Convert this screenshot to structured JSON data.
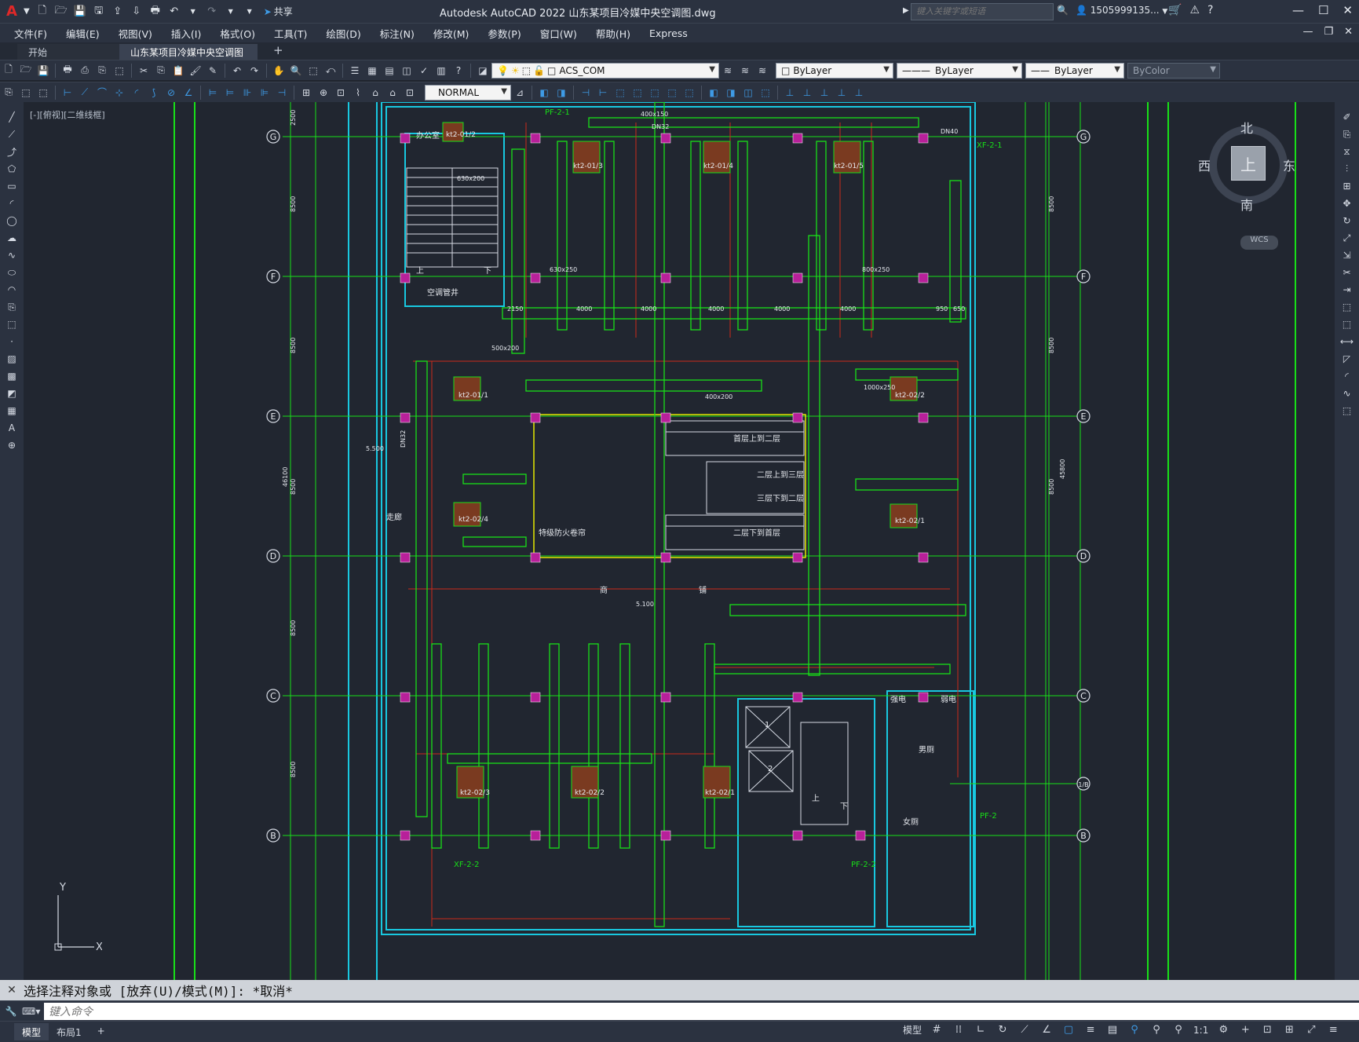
{
  "app": {
    "logo": "A",
    "title": "Autodesk AutoCAD 2022    山东某项目冷媒中央空调图.dwg",
    "share_label": "共享",
    "search_placeholder": "键入关键字或短语",
    "user": "1505999135...",
    "window_controls": [
      "—",
      "☐",
      "✕"
    ]
  },
  "menu": {
    "items": [
      "文件(F)",
      "编辑(E)",
      "视图(V)",
      "插入(I)",
      "格式(O)",
      "工具(T)",
      "绘图(D)",
      "标注(N)",
      "修改(M)",
      "参数(P)",
      "窗口(W)",
      "帮助(H)",
      "Express"
    ],
    "right_controls": [
      "—",
      "❐",
      "✕"
    ]
  },
  "tabs": {
    "start": "开始",
    "doc": "山东某项目冷媒中央空调图*",
    "close": "✕",
    "add": "+"
  },
  "toolbar": {
    "layer_value": "ACS_COM",
    "color_value": "ByLayer",
    "linetype_value": "ByLayer",
    "lineweight_value": "ByLayer",
    "plotstyle_value": "ByColor",
    "dimstyle_value": "NORMAL"
  },
  "canvas": {
    "view_label": "[-][俯视][二维线框]",
    "viewcube": {
      "n": "北",
      "s": "南",
      "e": "东",
      "w": "西",
      "top": "上",
      "wcs": "WCS"
    },
    "ucs": {
      "x": "X",
      "y": "Y"
    },
    "grid_labels_left": [
      "G",
      "F",
      "E",
      "D",
      "C",
      "B"
    ],
    "grid_labels_right": [
      "G",
      "F",
      "E",
      "D",
      "C",
      "1/B",
      "B"
    ],
    "room_labels": {
      "office": "办公室",
      "ac_shaft": "空调管井",
      "corridor": "走廊",
      "fire_shutter": "特级防火卷帘",
      "escalator_1": "首层上到二层",
      "escalator_2": "二层上到三层",
      "escalator_3": "三层下到二层",
      "escalator_4": "二层下到首层",
      "shop_a": "商",
      "shop_b": "铺",
      "strong_elec": "强电",
      "weak_elec": "弱电",
      "mens_wc": "男厕",
      "womens_wc": "女厕",
      "elev_1": "1",
      "elev_2": "2",
      "up1": "上",
      "down1": "下",
      "up2": "上",
      "down2": "下"
    },
    "unit_labels": [
      "kt2-01/2",
      "kt2-01/3",
      "kt2-01/4",
      "kt2-01/5",
      "kt2-01/1",
      "kt2-02/4",
      "kt2-02/3",
      "kt2-02/2",
      "kt2-02/1",
      "kt2-02/2",
      "kt2-02/1"
    ],
    "fan_labels": {
      "pf21": "PF-2-1",
      "xf21": "XF-2-1",
      "xf22": "XF-2-2",
      "pf22": "PF-2-2",
      "pf2": "PF-2"
    },
    "dims_top": [
      "2150",
      "4000",
      "4000",
      "4000",
      "4000",
      "4000",
      "950",
      "650"
    ],
    "duct_sizes": [
      "400x150",
      "500x200",
      "630x250",
      "630x200",
      "1000x250",
      "800x250",
      "400x200"
    ],
    "left_dims": [
      "2500",
      "8500",
      "8500",
      "8500",
      "8500",
      "8500",
      "46100"
    ],
    "right_dims": [
      "8500",
      "8500",
      "8500",
      "45800"
    ],
    "pipe_labels": [
      "DN32",
      "DN40",
      "DN32"
    ],
    "elevations": [
      "5.500",
      "5.100"
    ]
  },
  "command": {
    "history": "选择注释对象或 [放弃(U)/模式(M)]: *取消*",
    "placeholder": "键入命令"
  },
  "status": {
    "model_tab": "模型",
    "layout_tab": "布局1",
    "add_tab": "+",
    "model_button": "模型",
    "scale": "1:1"
  }
}
